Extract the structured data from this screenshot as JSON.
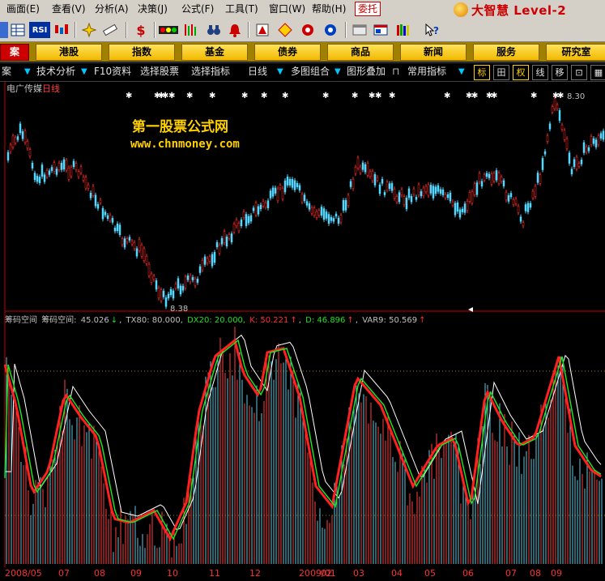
{
  "menu": {
    "items": [
      "画面(E)",
      "查看(V)",
      "分析(A)",
      "决策(J)",
      "公式(F)",
      "工具(T)",
      "窗口(W)",
      "帮助(H)"
    ],
    "active": "委托",
    "brand": "大智慧 Level-2"
  },
  "toolbar": {
    "rsi_label": "RSI",
    "dollar_label": "$"
  },
  "nav": {
    "first_label": "案",
    "buttons": [
      "港股",
      "指数",
      "基金",
      "债券",
      "商品",
      "新闻",
      "服务",
      "研究室"
    ]
  },
  "funcbar": {
    "left_label": "案",
    "items": [
      "技术分析",
      "F10资料",
      "选择股票",
      "选择指标",
      "日线",
      "多图组合",
      "图形叠加",
      "常用指标"
    ],
    "boxes": [
      "标",
      "田",
      "权",
      "线",
      "移",
      "⊡",
      "▦"
    ]
  },
  "stock": {
    "name": "电广传媒",
    "period": "日线"
  },
  "watermark": {
    "line1": "第一股票公式网",
    "line2": "www.chnmoney.com"
  },
  "price_labels": {
    "high": "8.30",
    "low": "8.38"
  },
  "indicator": {
    "name": "筹码空间",
    "label": "筹码空间:",
    "value": "45.026",
    "tx80": "TX80: 80.000,",
    "dx20": "DX20: 20.000,",
    "k": "K: 50.221",
    "d": "D: 46.896",
    "var9": "VAR9: 50.569"
  },
  "dates": [
    "2008/05",
    "07",
    "08",
    "09",
    "10",
    "11",
    "12",
    "2009/01",
    "02",
    "03",
    "04",
    "05",
    "06",
    "07",
    "08",
    "09"
  ],
  "colors": {
    "up": "#ff3030",
    "down": "#54d8ff",
    "k_line": "#ff2020",
    "d_line": "#20e020",
    "var_line": "#ffffff",
    "accent": "#ffd000"
  }
}
